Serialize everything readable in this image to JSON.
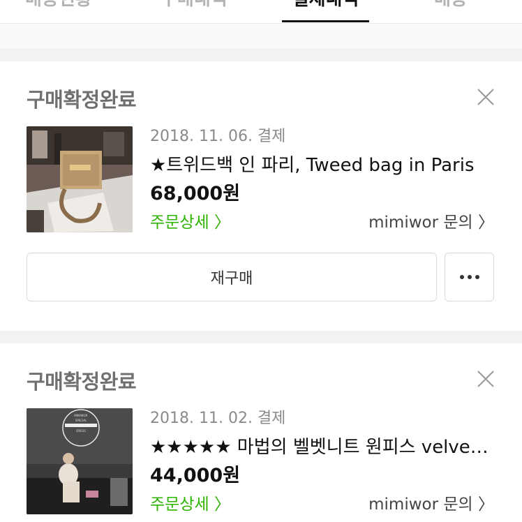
{
  "tabs": [
    {
      "label": "배송현황"
    },
    {
      "label": "구매내역"
    },
    {
      "label": "결제내역"
    },
    {
      "label": "배송"
    }
  ],
  "orders": [
    {
      "status": "구매확정완료",
      "date": "2018. 11. 06. 결제",
      "title": "★트위드백 인 파리, Tweed bag in Paris",
      "price": "68,000원",
      "detail_label": "주문상세 〉",
      "inquiry_label": "mimiwor 문의 〉",
      "rebuy_label": "재구매"
    },
    {
      "status": "구매확정완료",
      "date": "2018. 11. 02. 결제",
      "title": "★★★★★ 마법의 벨벳니트 원피스 velvet knit dress",
      "price": "44,000원",
      "detail_label": "주문상세 〉",
      "inquiry_label": "mimiwor 문의 〉",
      "thumb_text": "MIMIWOR SPECIAL VELVET KNIT DRESS"
    }
  ],
  "colors": {
    "accent_green": "#2db400",
    "status_gray": "#6f6f6f",
    "background_gap": "#f2f2f2"
  }
}
